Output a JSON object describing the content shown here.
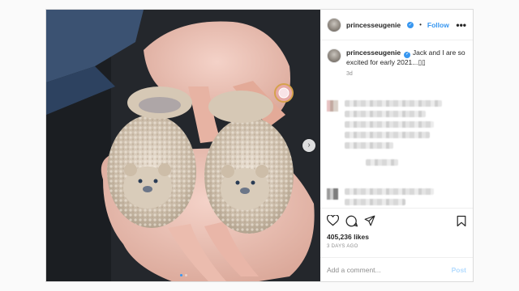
{
  "post": {
    "username": "princesseugenie",
    "follow_label": "Follow",
    "bullet": "•",
    "more_label": "•••",
    "caption_user": "princesseugenie",
    "caption_text": "Jack and I are so excited for early 2021...",
    "caption_emoji": "▯▯",
    "time_ago": "3d",
    "likes": "405,236 likes",
    "date": "3 DAYS AGO",
    "comment_placeholder": "Add a comment...",
    "post_button": "Post",
    "carousel_next": "›",
    "carousel_dots": 2,
    "carousel_active_dot": 1
  },
  "icons": {
    "verified": "verified-badge-icon",
    "like": "heart-icon",
    "comment": "comment-icon",
    "share": "share-icon",
    "save": "bookmark-icon"
  },
  "colors": {
    "accent": "#3897f0",
    "post_disabled": "#b3dbff",
    "muted_text": "#8e8e8e"
  }
}
